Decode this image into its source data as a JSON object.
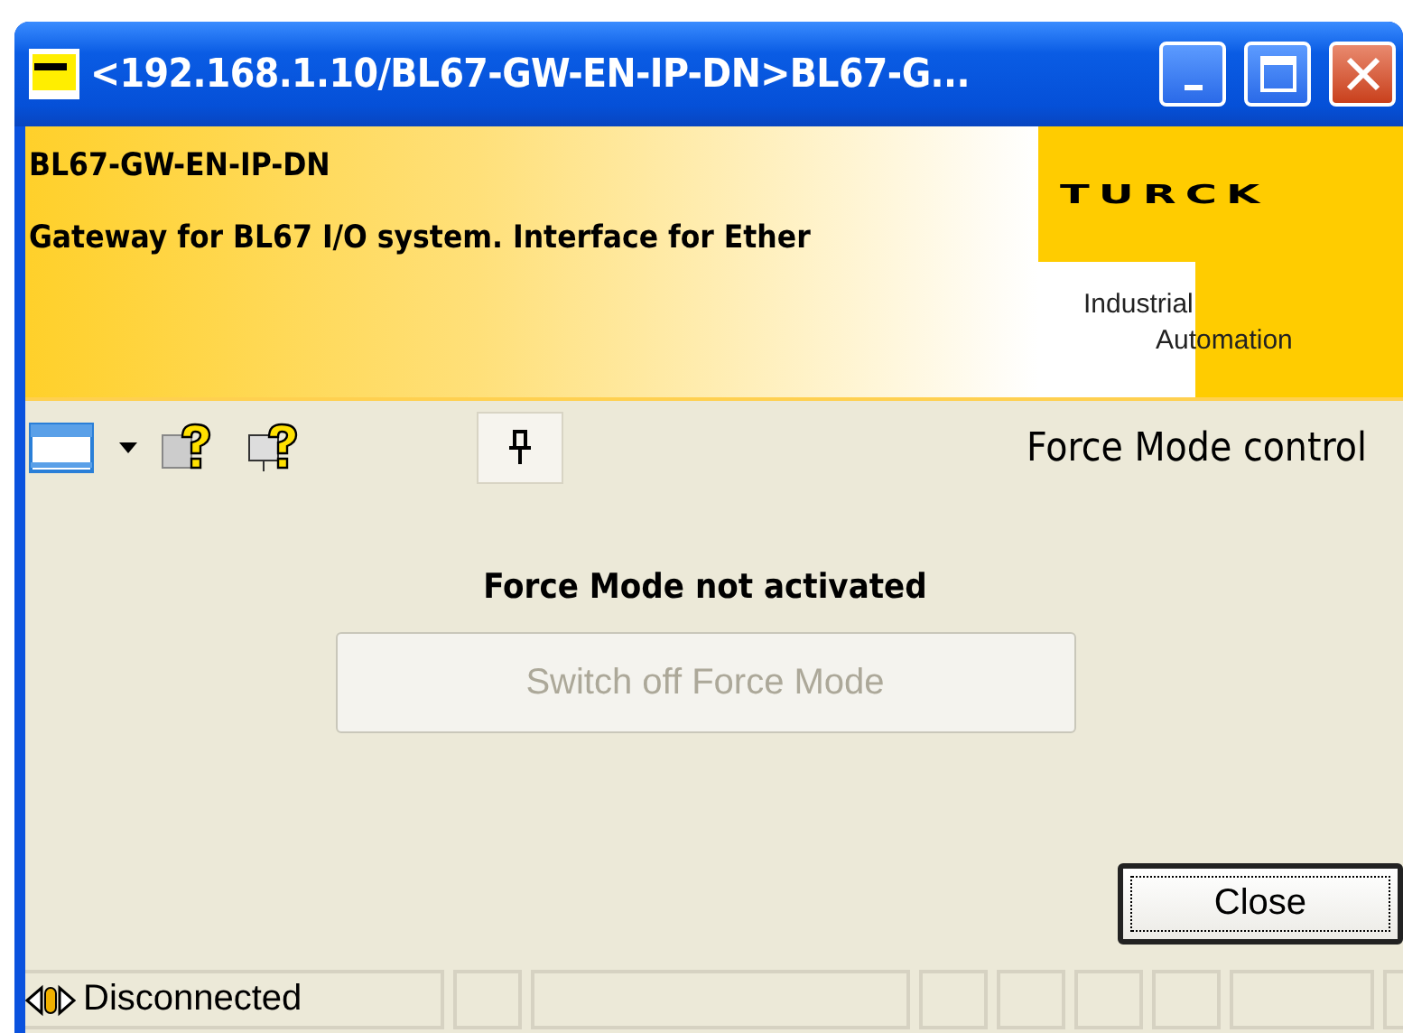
{
  "window": {
    "title": "<192.168.1.10/BL67-GW-EN-IP-DN>BL67-G..."
  },
  "banner": {
    "device": "BL67-GW-EN-IP-DN",
    "description": "Gateway for BL67 I/O system. Interface for Ether",
    "logo": "TURCK",
    "tagline_1": "Industrial",
    "tagline_2": "Automation"
  },
  "toolbar": {
    "pin_pressed": true,
    "heading": "Force Mode control"
  },
  "content": {
    "status": "Force Mode not activated",
    "buttons": [
      {
        "label": "Switch off Force Mode",
        "disabled": true
      },
      {
        "label": "Close",
        "disabled": false
      }
    ]
  },
  "status_bar": {
    "connection": "Disconnected"
  }
}
